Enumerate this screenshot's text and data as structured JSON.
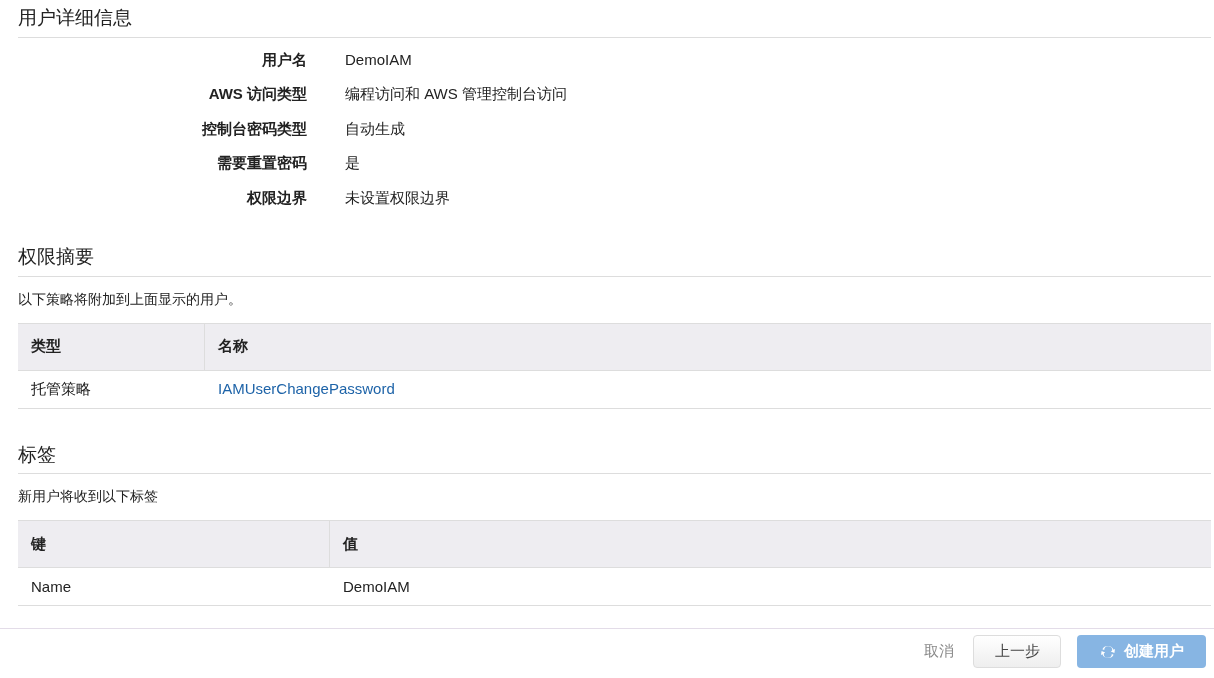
{
  "user_details": {
    "heading": "用户详细信息",
    "rows": [
      {
        "label": "用户名",
        "value": "DemoIAM"
      },
      {
        "label": "AWS 访问类型",
        "value": "编程访问和 AWS 管理控制台访问"
      },
      {
        "label": "控制台密码类型",
        "value": "自动生成"
      },
      {
        "label": "需要重置密码",
        "value": "是"
      },
      {
        "label": "权限边界",
        "value": "未设置权限边界"
      }
    ]
  },
  "permissions": {
    "heading": "权限摘要",
    "description": "以下策略将附加到上面显示的用户。",
    "table": {
      "columns": [
        "类型",
        "名称"
      ],
      "rows": [
        [
          {
            "text": "托管策略",
            "kind": "text"
          },
          {
            "text": "IAMUserChangePassword",
            "kind": "link"
          }
        ]
      ]
    }
  },
  "tags": {
    "heading": "标签",
    "description": "新用户将收到以下标签",
    "table": {
      "columns": [
        "键",
        "值"
      ],
      "rows": [
        [
          {
            "text": "Name",
            "kind": "text"
          },
          {
            "text": "DemoIAM",
            "kind": "text"
          }
        ]
      ]
    }
  },
  "buttons": [
    {
      "label": "取消",
      "kind": "link",
      "disabled": false
    },
    {
      "label": "上一步",
      "kind": "secondary",
      "disabled": false
    },
    {
      "label": "创建用户",
      "kind": "primary",
      "disabled": true
    }
  ]
}
